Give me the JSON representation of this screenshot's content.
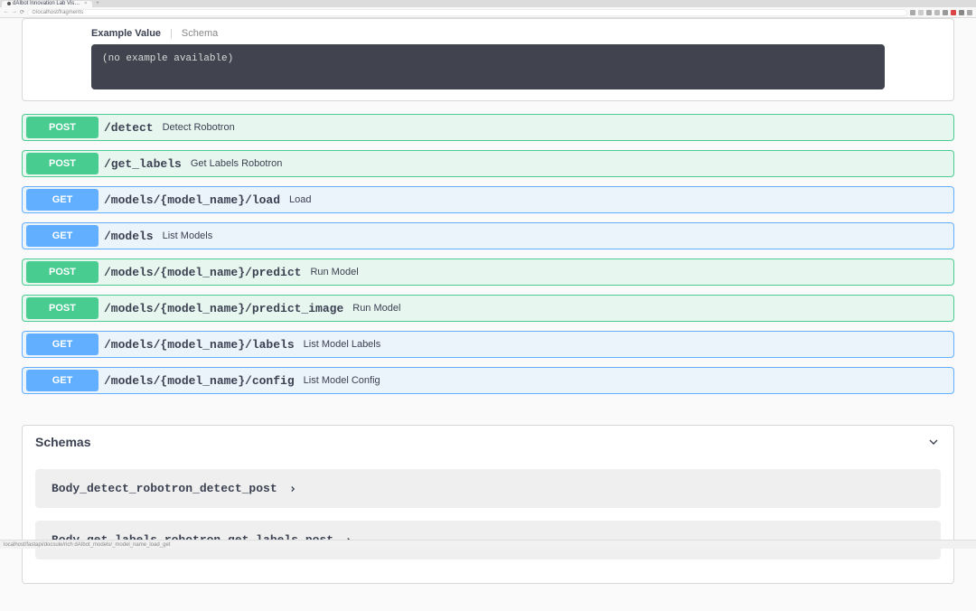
{
  "browser": {
    "tab_title": "dAIbot Innovation Lab Vis…",
    "url": "localhost/fragments"
  },
  "response": {
    "tab_example": "Example Value",
    "tab_schema": "Schema",
    "example_text": "(no example available)"
  },
  "endpoints": [
    {
      "method": "POST",
      "method_class": "post",
      "path": "/detect",
      "summary": "Detect Robotron"
    },
    {
      "method": "POST",
      "method_class": "post",
      "path": "/get_labels",
      "summary": "Get Labels Robotron"
    },
    {
      "method": "GET",
      "method_class": "get",
      "path": "/models/{model_name}/load",
      "summary": "Load"
    },
    {
      "method": "GET",
      "method_class": "get",
      "path": "/models",
      "summary": "List Models"
    },
    {
      "method": "POST",
      "method_class": "post",
      "path": "/models/{model_name}/predict",
      "summary": "Run Model"
    },
    {
      "method": "POST",
      "method_class": "post",
      "path": "/models/{model_name}/predict_image",
      "summary": "Run Model"
    },
    {
      "method": "GET",
      "method_class": "get",
      "path": "/models/{model_name}/labels",
      "summary": "List Model Labels"
    },
    {
      "method": "GET",
      "method_class": "get",
      "path": "/models/{model_name}/config",
      "summary": "List Model Config"
    }
  ],
  "schemas": {
    "title": "Schemas",
    "items": [
      {
        "name": "Body_detect_robotron_detect_post"
      },
      {
        "name": "Body_get_labels_robotron_get_labels_post"
      }
    ]
  },
  "status": "localhost/fastapi/docsule/rich dAIbot_models/_model_name_load_get"
}
